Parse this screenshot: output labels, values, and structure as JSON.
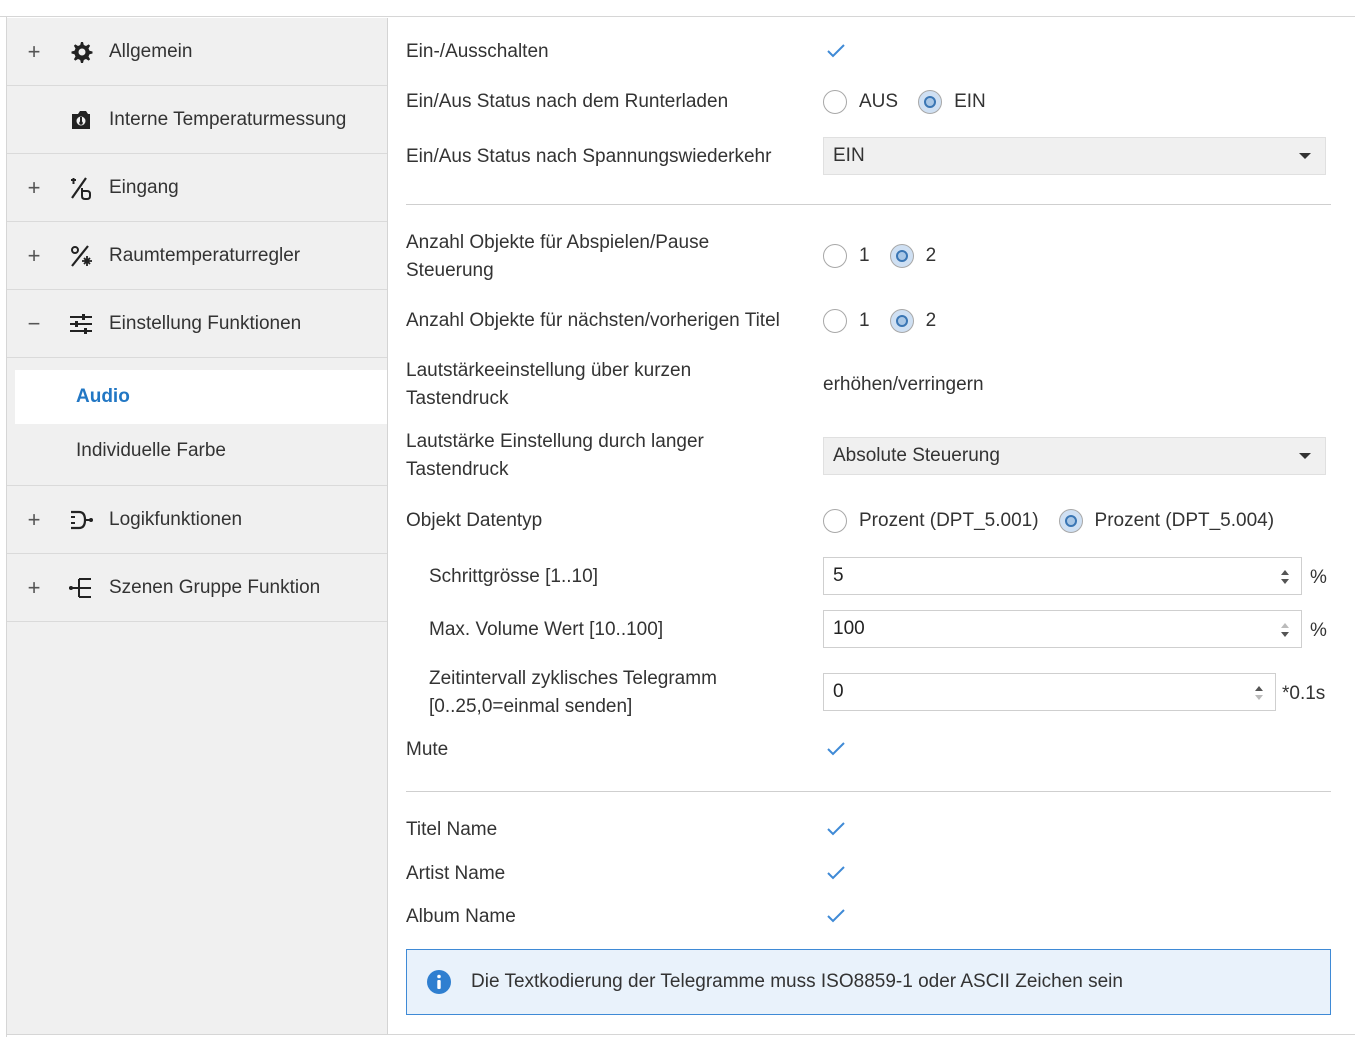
{
  "sidebar": {
    "items": [
      {
        "expander": "+",
        "icon": "gear-icon",
        "label": "Allgemein"
      },
      {
        "expander": "",
        "icon": "thermometer-camera-icon",
        "label": "Interne Temperaturmessung"
      },
      {
        "expander": "+",
        "icon": "input-icon",
        "label": "Eingang"
      },
      {
        "expander": "+",
        "icon": "temperature-controller-icon",
        "label": "Raumtemperaturregler"
      },
      {
        "expander": "−",
        "icon": "sliders-icon",
        "label": "Einstellung Funktionen"
      },
      {
        "expander": "+",
        "icon": "logic-icon",
        "label": "Logikfunktionen"
      },
      {
        "expander": "+",
        "icon": "scene-group-icon",
        "label": "Szenen Gruppe Funktion"
      }
    ],
    "subitems": [
      {
        "label": "Audio",
        "active": true
      },
      {
        "label": "Individuelle Farbe",
        "active": false
      }
    ]
  },
  "main": {
    "onoff": {
      "label": "Ein-/Ausschalten",
      "checked": true
    },
    "status_download": {
      "label": "Ein/Aus Status nach dem Runterladen",
      "options": [
        "AUS",
        "EIN"
      ],
      "selected": "EIN"
    },
    "status_power": {
      "label": "Ein/Aus Status nach Spannungswiederkehr",
      "value": "EIN"
    },
    "play_pause": {
      "label_line1": "Anzahl Objekte für Abspielen/Pause",
      "label_line2": "Steuerung",
      "options": [
        "1",
        "2"
      ],
      "selected": "2"
    },
    "next_prev": {
      "label": "Anzahl Objekte für nächsten/vorherigen Titel",
      "options": [
        "1",
        "2"
      ],
      "selected": "2"
    },
    "volume_short": {
      "label_line1": "Lautstärkeeinstellung über kurzen",
      "label_line2": "Tastendruck",
      "value": "erhöhen/verringern"
    },
    "volume_long": {
      "label_line1": "Lautstärke Einstellung durch langer",
      "label_line2": "Tastendruck",
      "value": "Absolute Steuerung"
    },
    "datatype": {
      "label": "Objekt Datentyp",
      "options": [
        "Prozent (DPT_5.001)",
        "Prozent (DPT_5.004)"
      ],
      "selected": "Prozent (DPT_5.004)"
    },
    "step_size": {
      "label": "Schrittgrösse [1..10]",
      "value": "5",
      "unit": "%"
    },
    "max_volume": {
      "label": "Max. Volume Wert [10..100]",
      "value": "100",
      "unit": "%"
    },
    "interval": {
      "label_line1": "Zeitintervall zyklisches Telegramm",
      "label_line2": "[0..25,0=einmal senden]",
      "value": "0",
      "unit": "*0.1s"
    },
    "mute": {
      "label": "Mute",
      "checked": true
    },
    "title_name": {
      "label": "Titel Name",
      "checked": true
    },
    "artist_name": {
      "label": "Artist Name",
      "checked": true
    },
    "album_name": {
      "label": "Album Name",
      "checked": true
    },
    "info": {
      "text": "Die Textkodierung der Telegramme muss ISO8859-1 oder ASCII Zeichen sein"
    }
  },
  "colors": {
    "accent": "#2277c4",
    "check": "#3f8ad6",
    "info_bg": "#e9f2fb",
    "info_border": "#3f8ad6",
    "sidebar_bg": "#f0f0f0"
  }
}
